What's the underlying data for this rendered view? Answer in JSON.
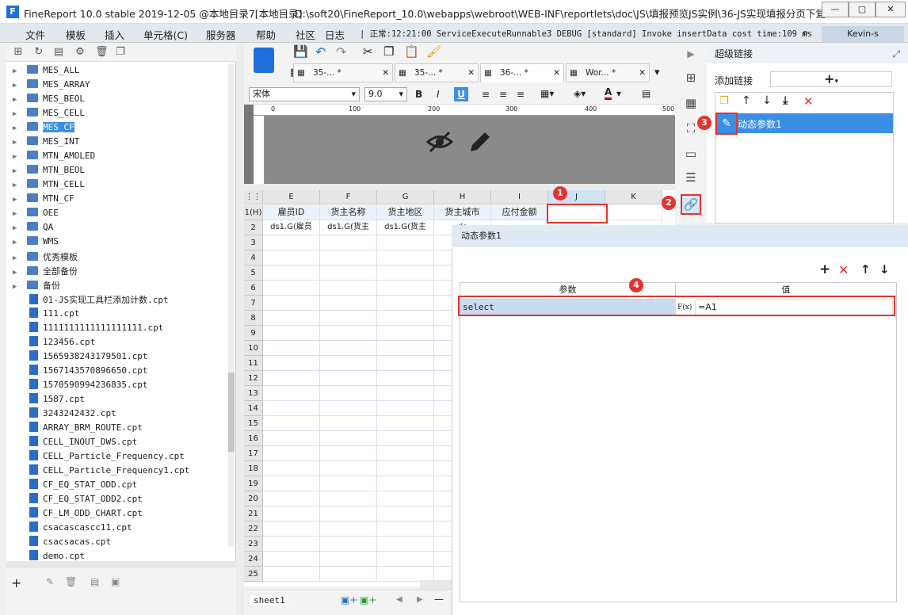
{
  "window": {
    "title": "FineReport 10.0 stable 2019-12-05 @本地目录7[本地目录]",
    "path": "D:\\soft20\\FineReport_10.0\\webapps\\webroot\\WEB-INF\\reportlets\\doc\\JS\\填报预览JS实例\\36-JS实现填报分页下复...",
    "min_label": "—",
    "max_label": "▢",
    "close_label": "✕"
  },
  "menubar": {
    "items": [
      "文件",
      "模板",
      "插入",
      "单元格(C)",
      "服务器",
      "帮助",
      "社区",
      "日志"
    ],
    "status": "| 正常:12:21:00 ServiceExecuteRunnable3 DEBUG [standard] Invoke insertData cost time:109 ms",
    "user": "Kevin-s"
  },
  "tree": {
    "items": [
      {
        "label": "MES_ALL",
        "type": "folder"
      },
      {
        "label": "MES_ARRAY",
        "type": "folder"
      },
      {
        "label": "MES_BEOL",
        "type": "folder"
      },
      {
        "label": "MES_CELL",
        "type": "folder"
      },
      {
        "label": "MES_CF",
        "type": "folder",
        "selected": true
      },
      {
        "label": "MES_INT",
        "type": "folder"
      },
      {
        "label": "MTN_AMOLED",
        "type": "folder"
      },
      {
        "label": "MTN_BEOL",
        "type": "folder"
      },
      {
        "label": "MTN_CELL",
        "type": "folder"
      },
      {
        "label": "MTN_CF",
        "type": "folder"
      },
      {
        "label": "OEE",
        "type": "folder"
      },
      {
        "label": "QA",
        "type": "folder"
      },
      {
        "label": "WMS",
        "type": "folder"
      },
      {
        "label": "优秀模板",
        "type": "folder"
      },
      {
        "label": "全部备份",
        "type": "folder"
      },
      {
        "label": "备份",
        "type": "folder"
      },
      {
        "label": "01-JS实现工具栏添加计数.cpt",
        "type": "file"
      },
      {
        "label": "111.cpt",
        "type": "file"
      },
      {
        "label": "1111111111111111111.cpt",
        "type": "file"
      },
      {
        "label": "123456.cpt",
        "type": "file"
      },
      {
        "label": "1565938243179501.cpt",
        "type": "file"
      },
      {
        "label": "1567143570896650.cpt",
        "type": "file"
      },
      {
        "label": "1570590994236835.cpt",
        "type": "file"
      },
      {
        "label": "1587.cpt",
        "type": "file"
      },
      {
        "label": "3243242432.cpt",
        "type": "file"
      },
      {
        "label": "ARRAY_BRM_ROUTE.cpt",
        "type": "file"
      },
      {
        "label": "CELL_INOUT_DWS.cpt",
        "type": "file"
      },
      {
        "label": "CELL_Particle_Frequency.cpt",
        "type": "file"
      },
      {
        "label": "CELL_Particle_Frequency1.cpt",
        "type": "file"
      },
      {
        "label": "CF_EQ_STAT_ODD.cpt",
        "type": "file"
      },
      {
        "label": "CF_EQ_STAT_ODD2.cpt",
        "type": "file"
      },
      {
        "label": "CF_LM_ODD_CHART.cpt",
        "type": "file"
      },
      {
        "label": "csacascascc11.cpt",
        "type": "file"
      },
      {
        "label": "csacsacas.cpt",
        "type": "file"
      },
      {
        "label": "demo.cpt",
        "type": "file"
      }
    ]
  },
  "editor": {
    "tabs": [
      {
        "label": "35-...",
        "mod": "*"
      },
      {
        "label": "35-...",
        "mod": "*"
      },
      {
        "label": "36-...",
        "mod": "*"
      },
      {
        "label": "Wor...",
        "mod": "*"
      }
    ],
    "font": "宋体",
    "font_size": "9.0",
    "ruler_ticks": [
      "0",
      "100",
      "200",
      "300",
      "400",
      "500"
    ],
    "columns": [
      "E",
      "F",
      "G",
      "H",
      "I",
      "J",
      "K"
    ],
    "row_labels": [
      "1(H)",
      "2",
      "3",
      "4",
      "5",
      "6",
      "7",
      "8",
      "9",
      "10",
      "11",
      "12",
      "13",
      "14",
      "15",
      "16",
      "17",
      "18",
      "19",
      "20",
      "21",
      "22",
      "23",
      "24",
      "25"
    ],
    "header_row": [
      "雇员ID",
      "货主名称",
      "货主地区",
      "货主城市",
      "应付金额",
      "",
      ""
    ],
    "data_row": [
      "ds1.G(雇员",
      "ds1.G(货主",
      "ds1.G(货主",
      "ds",
      "",
      "",
      ""
    ],
    "sheet_tab": "sheet1"
  },
  "hyperlink": {
    "title": "超级链接",
    "add_label": "添加链接",
    "add_button": "+",
    "items": [
      "动态参数1"
    ]
  },
  "dynamic_param": {
    "title": "动态参数1",
    "col_param": "参数",
    "col_value": "值",
    "rows": [
      {
        "param": "select",
        "fx": "F(x)",
        "value": "=A1"
      }
    ]
  },
  "badges": [
    "1",
    "2",
    "3",
    "4"
  ]
}
